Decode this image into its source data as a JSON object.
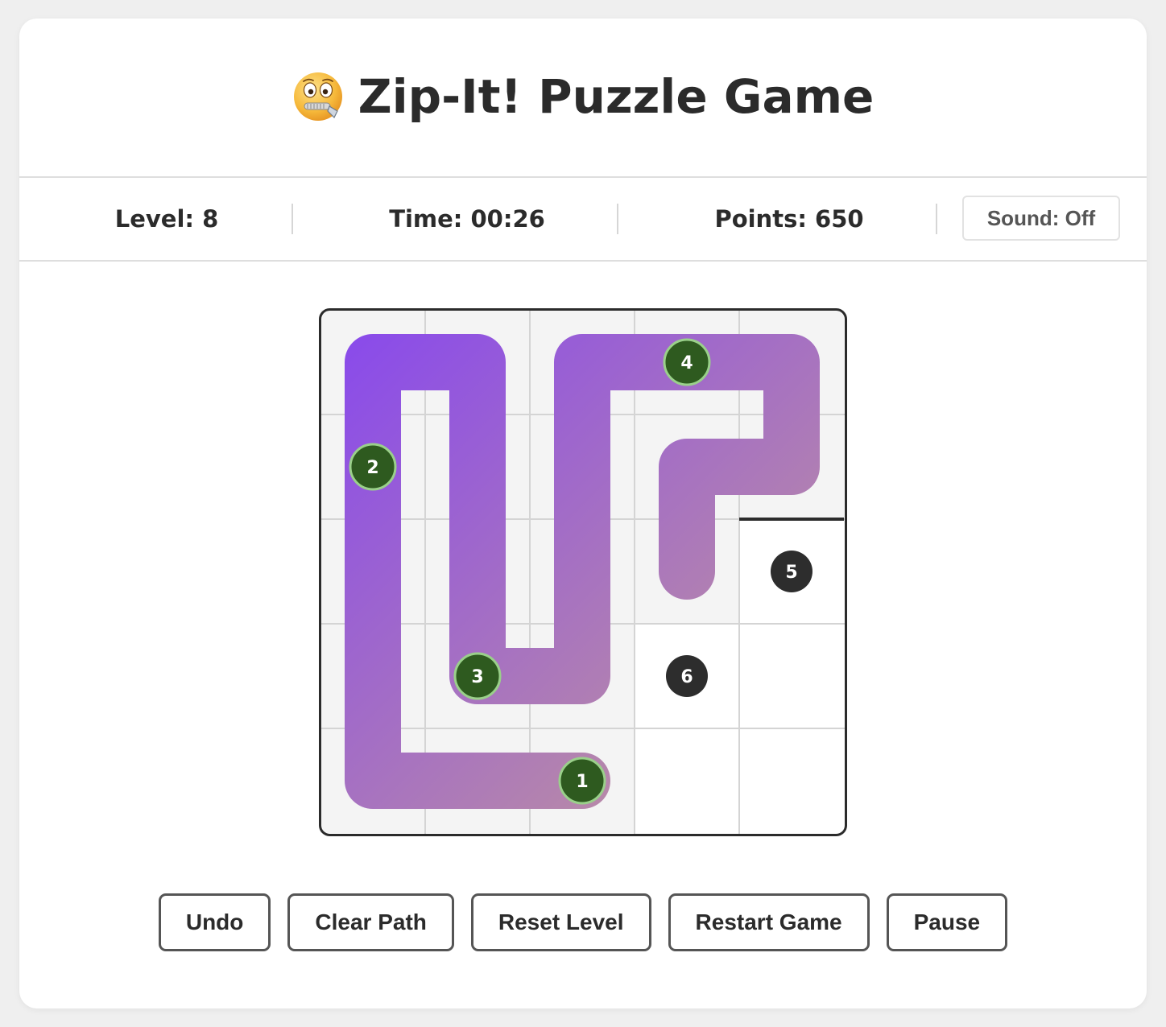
{
  "header": {
    "title": "Zip-It! Puzzle Game",
    "icon": "zipper-mouth-face-icon"
  },
  "stats": {
    "level": "Level: 8",
    "time": "Time: 00:26",
    "points": "Points: 650",
    "sound_label": "Sound: Off"
  },
  "board": {
    "rows": 5,
    "cols": 5,
    "path_gradient": [
      "#8a4bea",
      "#c49a96"
    ],
    "cell_visited_color": "#f4f4f4",
    "cell_empty_color": "#ffffff",
    "node_visited_color": "#2e5a1f",
    "node_unvisited_color": "#2d2d2d",
    "nodes": [
      {
        "label": "1",
        "row": 4,
        "col": 2,
        "visited": true
      },
      {
        "label": "2",
        "row": 1,
        "col": 0,
        "visited": true
      },
      {
        "label": "3",
        "row": 3,
        "col": 1,
        "visited": true
      },
      {
        "label": "4",
        "row": 0,
        "col": 3,
        "visited": true
      },
      {
        "label": "5",
        "row": 2,
        "col": 4,
        "visited": false
      },
      {
        "label": "6",
        "row": 3,
        "col": 3,
        "visited": false
      }
    ],
    "path": [
      [
        4,
        2
      ],
      [
        4,
        1
      ],
      [
        4,
        0
      ],
      [
        3,
        0
      ],
      [
        2,
        0
      ],
      [
        1,
        0
      ],
      [
        0,
        0
      ],
      [
        0,
        1
      ],
      [
        1,
        1
      ],
      [
        2,
        1
      ],
      [
        3,
        1
      ],
      [
        3,
        2
      ],
      [
        2,
        2
      ],
      [
        1,
        2
      ],
      [
        0,
        2
      ],
      [
        0,
        3
      ],
      [
        0,
        4
      ],
      [
        1,
        4
      ],
      [
        1,
        3
      ],
      [
        2,
        3
      ]
    ],
    "walls": [
      {
        "row": 1,
        "col": 4,
        "side": "bottom"
      }
    ]
  },
  "controls": {
    "undo": "Undo",
    "clear_path": "Clear Path",
    "reset_level": "Reset Level",
    "restart_game": "Restart Game",
    "pause": "Pause"
  }
}
